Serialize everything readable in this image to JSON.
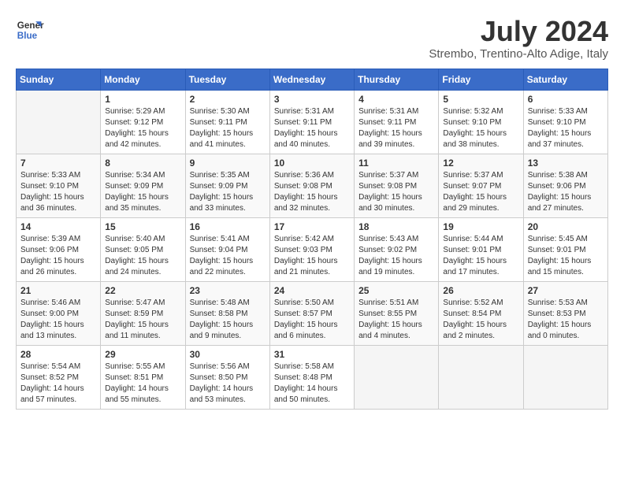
{
  "header": {
    "logo_line1": "General",
    "logo_line2": "Blue",
    "month": "July 2024",
    "location": "Strembo, Trentino-Alto Adige, Italy"
  },
  "days_of_week": [
    "Sunday",
    "Monday",
    "Tuesday",
    "Wednesday",
    "Thursday",
    "Friday",
    "Saturday"
  ],
  "weeks": [
    [
      {
        "day": "",
        "info": ""
      },
      {
        "day": "1",
        "info": "Sunrise: 5:29 AM\nSunset: 9:12 PM\nDaylight: 15 hours\nand 42 minutes."
      },
      {
        "day": "2",
        "info": "Sunrise: 5:30 AM\nSunset: 9:11 PM\nDaylight: 15 hours\nand 41 minutes."
      },
      {
        "day": "3",
        "info": "Sunrise: 5:31 AM\nSunset: 9:11 PM\nDaylight: 15 hours\nand 40 minutes."
      },
      {
        "day": "4",
        "info": "Sunrise: 5:31 AM\nSunset: 9:11 PM\nDaylight: 15 hours\nand 39 minutes."
      },
      {
        "day": "5",
        "info": "Sunrise: 5:32 AM\nSunset: 9:10 PM\nDaylight: 15 hours\nand 38 minutes."
      },
      {
        "day": "6",
        "info": "Sunrise: 5:33 AM\nSunset: 9:10 PM\nDaylight: 15 hours\nand 37 minutes."
      }
    ],
    [
      {
        "day": "7",
        "info": "Sunrise: 5:33 AM\nSunset: 9:10 PM\nDaylight: 15 hours\nand 36 minutes."
      },
      {
        "day": "8",
        "info": "Sunrise: 5:34 AM\nSunset: 9:09 PM\nDaylight: 15 hours\nand 35 minutes."
      },
      {
        "day": "9",
        "info": "Sunrise: 5:35 AM\nSunset: 9:09 PM\nDaylight: 15 hours\nand 33 minutes."
      },
      {
        "day": "10",
        "info": "Sunrise: 5:36 AM\nSunset: 9:08 PM\nDaylight: 15 hours\nand 32 minutes."
      },
      {
        "day": "11",
        "info": "Sunrise: 5:37 AM\nSunset: 9:08 PM\nDaylight: 15 hours\nand 30 minutes."
      },
      {
        "day": "12",
        "info": "Sunrise: 5:37 AM\nSunset: 9:07 PM\nDaylight: 15 hours\nand 29 minutes."
      },
      {
        "day": "13",
        "info": "Sunrise: 5:38 AM\nSunset: 9:06 PM\nDaylight: 15 hours\nand 27 minutes."
      }
    ],
    [
      {
        "day": "14",
        "info": "Sunrise: 5:39 AM\nSunset: 9:06 PM\nDaylight: 15 hours\nand 26 minutes."
      },
      {
        "day": "15",
        "info": "Sunrise: 5:40 AM\nSunset: 9:05 PM\nDaylight: 15 hours\nand 24 minutes."
      },
      {
        "day": "16",
        "info": "Sunrise: 5:41 AM\nSunset: 9:04 PM\nDaylight: 15 hours\nand 22 minutes."
      },
      {
        "day": "17",
        "info": "Sunrise: 5:42 AM\nSunset: 9:03 PM\nDaylight: 15 hours\nand 21 minutes."
      },
      {
        "day": "18",
        "info": "Sunrise: 5:43 AM\nSunset: 9:02 PM\nDaylight: 15 hours\nand 19 minutes."
      },
      {
        "day": "19",
        "info": "Sunrise: 5:44 AM\nSunset: 9:01 PM\nDaylight: 15 hours\nand 17 minutes."
      },
      {
        "day": "20",
        "info": "Sunrise: 5:45 AM\nSunset: 9:01 PM\nDaylight: 15 hours\nand 15 minutes."
      }
    ],
    [
      {
        "day": "21",
        "info": "Sunrise: 5:46 AM\nSunset: 9:00 PM\nDaylight: 15 hours\nand 13 minutes."
      },
      {
        "day": "22",
        "info": "Sunrise: 5:47 AM\nSunset: 8:59 PM\nDaylight: 15 hours\nand 11 minutes."
      },
      {
        "day": "23",
        "info": "Sunrise: 5:48 AM\nSunset: 8:58 PM\nDaylight: 15 hours\nand 9 minutes."
      },
      {
        "day": "24",
        "info": "Sunrise: 5:50 AM\nSunset: 8:57 PM\nDaylight: 15 hours\nand 6 minutes."
      },
      {
        "day": "25",
        "info": "Sunrise: 5:51 AM\nSunset: 8:55 PM\nDaylight: 15 hours\nand 4 minutes."
      },
      {
        "day": "26",
        "info": "Sunrise: 5:52 AM\nSunset: 8:54 PM\nDaylight: 15 hours\nand 2 minutes."
      },
      {
        "day": "27",
        "info": "Sunrise: 5:53 AM\nSunset: 8:53 PM\nDaylight: 15 hours\nand 0 minutes."
      }
    ],
    [
      {
        "day": "28",
        "info": "Sunrise: 5:54 AM\nSunset: 8:52 PM\nDaylight: 14 hours\nand 57 minutes."
      },
      {
        "day": "29",
        "info": "Sunrise: 5:55 AM\nSunset: 8:51 PM\nDaylight: 14 hours\nand 55 minutes."
      },
      {
        "day": "30",
        "info": "Sunrise: 5:56 AM\nSunset: 8:50 PM\nDaylight: 14 hours\nand 53 minutes."
      },
      {
        "day": "31",
        "info": "Sunrise: 5:58 AM\nSunset: 8:48 PM\nDaylight: 14 hours\nand 50 minutes."
      },
      {
        "day": "",
        "info": ""
      },
      {
        "day": "",
        "info": ""
      },
      {
        "day": "",
        "info": ""
      }
    ]
  ]
}
